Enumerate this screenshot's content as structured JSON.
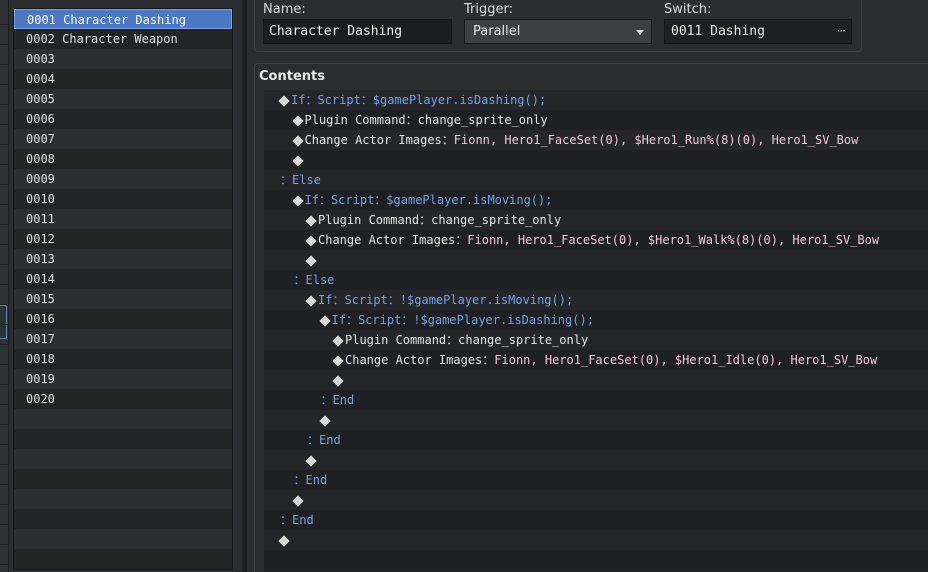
{
  "event_list": [
    "0001 Character Dashing",
    "0002 Character Weapon",
    "0003",
    "0004",
    "0005",
    "0006",
    "0007",
    "0008",
    "0009",
    "0010",
    "0011",
    "0012",
    "0013",
    "0014",
    "0015",
    "0016",
    "0017",
    "0018",
    "0019",
    "0020",
    "",
    "",
    "",
    "",
    "",
    "",
    "",
    ""
  ],
  "selected_index": 0,
  "header": {
    "name_label": "Name:",
    "name_value": "Character Dashing",
    "trigger_label": "Trigger:",
    "trigger_value": "Parallel",
    "switch_label": "Switch:",
    "switch_value": "0011 Dashing",
    "switch_button": "···"
  },
  "contents_title": "Contents",
  "colors": {
    "keyword": "#6fa3e6",
    "text": "#e6e6e6",
    "args": "#f2c8dc",
    "selection": "#4a78c5"
  },
  "code_lines": [
    {
      "indent": 0,
      "diamond": true,
      "segs": [
        [
          "If：Script：$gamePlayer.isDashing();",
          "blue"
        ]
      ]
    },
    {
      "indent": 1,
      "diamond": true,
      "segs": [
        [
          "Plugin Command：",
          "white"
        ],
        [
          "change_sprite_only",
          "white"
        ]
      ]
    },
    {
      "indent": 1,
      "diamond": true,
      "segs": [
        [
          "Change Actor Images：",
          "white"
        ],
        [
          "Fionn, Hero1_FaceSet(0), $Hero1_Run%(8)(0), Hero1_SV_Bow",
          "pink"
        ]
      ]
    },
    {
      "indent": 1,
      "diamond": true,
      "segs": []
    },
    {
      "indent": 0,
      "diamond": false,
      "segs": [
        [
          "：Else",
          "blue"
        ]
      ]
    },
    {
      "indent": 1,
      "diamond": true,
      "segs": [
        [
          "If：Script：$gamePlayer.isMoving();",
          "blue"
        ]
      ]
    },
    {
      "indent": 2,
      "diamond": true,
      "segs": [
        [
          "Plugin Command：",
          "white"
        ],
        [
          "change_sprite_only",
          "white"
        ]
      ]
    },
    {
      "indent": 2,
      "diamond": true,
      "segs": [
        [
          "Change Actor Images：",
          "white"
        ],
        [
          "Fionn, Hero1_FaceSet(0), $Hero1_Walk%(8)(0), Hero1_SV_Bow",
          "pink"
        ]
      ]
    },
    {
      "indent": 2,
      "diamond": true,
      "segs": []
    },
    {
      "indent": 1,
      "diamond": false,
      "segs": [
        [
          "：Else",
          "blue"
        ]
      ]
    },
    {
      "indent": 2,
      "diamond": true,
      "segs": [
        [
          "If：Script：!$gamePlayer.isMoving();",
          "blue"
        ]
      ]
    },
    {
      "indent": 3,
      "diamond": true,
      "segs": [
        [
          "If：Script：!$gamePlayer.isDashing();",
          "blue"
        ]
      ]
    },
    {
      "indent": 4,
      "diamond": true,
      "segs": [
        [
          "Plugin Command：",
          "white"
        ],
        [
          "change_sprite_only",
          "white"
        ]
      ]
    },
    {
      "indent": 4,
      "diamond": true,
      "segs": [
        [
          "Change Actor Images：",
          "white"
        ],
        [
          "Fionn, Hero1_FaceSet(0), $Hero1_Idle(0), Hero1_SV_Bow",
          "pink"
        ]
      ]
    },
    {
      "indent": 4,
      "diamond": true,
      "segs": []
    },
    {
      "indent": 3,
      "diamond": false,
      "segs": [
        [
          "：End",
          "blue"
        ]
      ]
    },
    {
      "indent": 3,
      "diamond": true,
      "segs": []
    },
    {
      "indent": 2,
      "diamond": false,
      "segs": [
        [
          "：End",
          "blue"
        ]
      ]
    },
    {
      "indent": 2,
      "diamond": true,
      "segs": []
    },
    {
      "indent": 1,
      "diamond": false,
      "segs": [
        [
          "：End",
          "blue"
        ]
      ]
    },
    {
      "indent": 1,
      "diamond": true,
      "segs": []
    },
    {
      "indent": 0,
      "diamond": false,
      "segs": [
        [
          "：End",
          "blue"
        ]
      ]
    },
    {
      "indent": 0,
      "diamond": true,
      "segs": []
    },
    {
      "indent": 0,
      "diamond": false,
      "segs": []
    },
    {
      "indent": 0,
      "diamond": false,
      "segs": []
    }
  ]
}
